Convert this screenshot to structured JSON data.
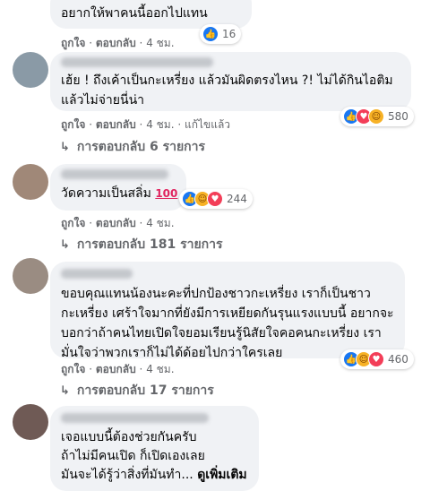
{
  "comments": [
    {
      "text": [
        "อยากให้พาคนนี้ออกไปแทน"
      ],
      "meta": {
        "like": "ถูกใจ",
        "reply": "ตอบกลับ",
        "time": "4 ชม."
      },
      "reactions": {
        "icons": [
          "like-icon"
        ],
        "count": "16"
      }
    },
    {
      "text": [
        "เฮ้ย ! ถึงเค้าเป็นกะเหรี่ยง แล้วมันผิดตรงไหน ?! ไม่ได้กินไอติม",
        "แล้วไม่จ่ายนี่น่า"
      ],
      "meta": {
        "like": "ถูกใจ",
        "reply": "ตอบกลับ",
        "time": "4 ชม.",
        "edited": "แก้ไขแล้ว"
      },
      "reactions": {
        "icons": [
          "like-icon",
          "love-icon",
          "haha-icon"
        ],
        "count": "580"
      },
      "replies": "การตอบกลับ 6 รายการ"
    },
    {
      "text": [
        "วัดความเป็นสลิ่ม"
      ],
      "emoji": "100",
      "meta": {
        "like": "ถูกใจ",
        "reply": "ตอบกลับ",
        "time": "4 ชม."
      },
      "reactions": {
        "icons": [
          "like-icon",
          "haha-icon",
          "love-icon"
        ],
        "count": "244"
      },
      "replies": "การตอบกลับ 181 รายการ"
    },
    {
      "text": [
        "ขอบคุณแทนน้องนะคะที่ปกป้องชาวกะเหรี่ยง เราก็เป็นชาว",
        "กะเหรี่ยง เศร้าใจมากที่ยังมีการเหยียดกันรุนแรงแบบนี้ อยากจะ",
        "บอกว่าถ้าคนไทยเปิดใจยอมเรียนรู้นิสัยใจคอคนกะเหรี่ยง เรา",
        "มั่นใจว่าพวกเราก็ไม่ได้ด้อยไปกว่าใครเลย"
      ],
      "meta": {
        "like": "ถูกใจ",
        "reply": "ตอบกลับ",
        "time": "4 ชม."
      },
      "reactions": {
        "icons": [
          "like-icon",
          "haha-icon",
          "love-icon"
        ],
        "count": "460"
      },
      "replies": "การตอบกลับ 17 รายการ"
    },
    {
      "text": [
        "เจอแบบนี้ต้องช่วยกันครับ",
        "ถ้าไม่มีคนเปิด ก็เปิดเองเลย",
        "มันจะได้รู้ว่าสิ่งที่มันทำ..."
      ],
      "see_more": "ดูเพิ่มเติม"
    }
  ]
}
